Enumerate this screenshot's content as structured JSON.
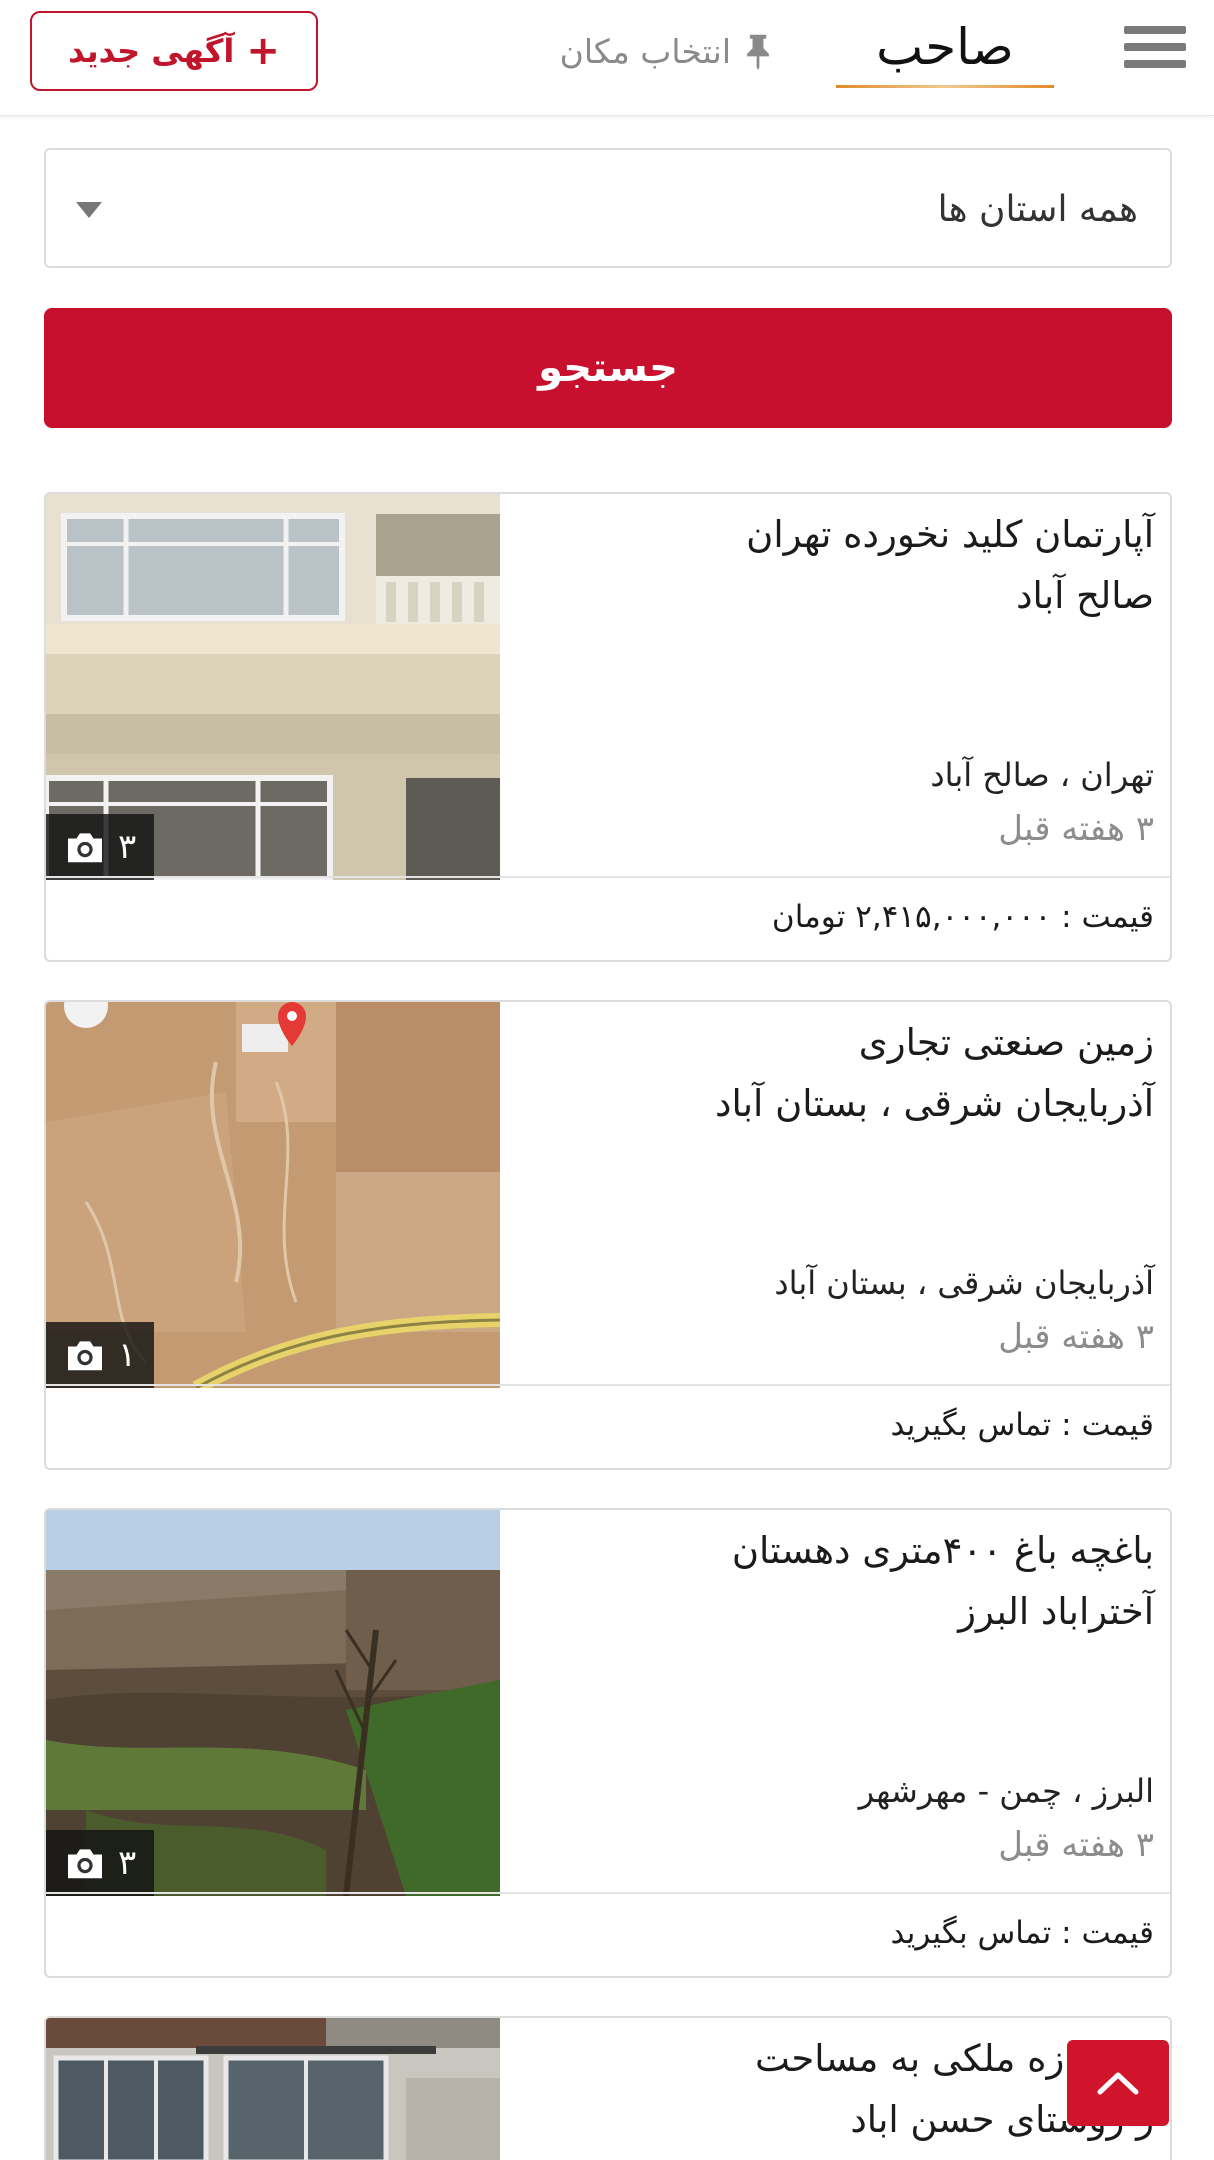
{
  "header": {
    "logo_text": "صاحب",
    "location_label": "انتخاب مکان",
    "new_ad_label": "آگهی جدید"
  },
  "filters": {
    "province_value": "همه استان ها",
    "search_label": "جستجو"
  },
  "listings": [
    {
      "title_line1": "آپارتمان کلید نخورده تهران",
      "title_line2": "صالح آباد",
      "location": "تهران ، صالح آباد",
      "time": "۳ هفته قبل",
      "price": "قیمت : ۲,۴۱۵,۰۰۰,۰۰۰ تومان",
      "photo_count": "۳"
    },
    {
      "title_line1": "زمین صنعتی تجاری",
      "title_line2": "آذربایجان شرقی ، بستان آباد",
      "location": "آذربایجان شرقی ، بستان آباد",
      "time": "۳ هفته قبل",
      "price": "قیمت : تماس بگیرید",
      "photo_count": "۱"
    },
    {
      "title_line1": "باغچه باغ ۴۰۰متری دهستان",
      "title_line2": "آختراباد البرز",
      "location": "البرز ، چمن - مهرشهر",
      "time": "۳ هفته قبل",
      "price": "قیمت : تماس بگیرید",
      "photo_count": "۳"
    },
    {
      "title_line1": "ی مغازه ملکی به مساحت",
      "title_line2": "ر روستای حسن اباد"
    }
  ],
  "colors": {
    "brand_red": "#c8102e",
    "muted_text": "#8c8c8c",
    "border": "#dcdcdc"
  },
  "icons": [
    "menu-icon",
    "pin-icon",
    "plus-icon",
    "caret-down-icon",
    "camera-icon",
    "chevron-up-icon"
  ]
}
